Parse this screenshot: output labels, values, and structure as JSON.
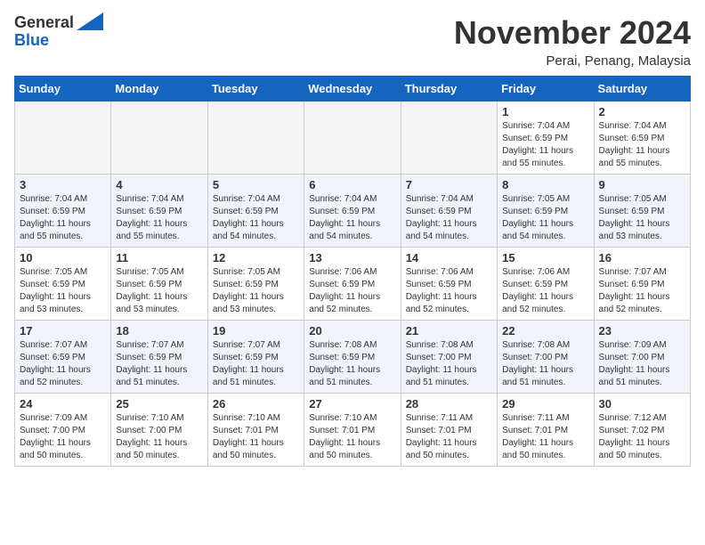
{
  "header": {
    "logo_line1": "General",
    "logo_line2": "Blue",
    "month_title": "November 2024",
    "location": "Perai, Penang, Malaysia"
  },
  "calendar": {
    "days_of_week": [
      "Sunday",
      "Monday",
      "Tuesday",
      "Wednesday",
      "Thursday",
      "Friday",
      "Saturday"
    ],
    "weeks": [
      [
        {
          "day": "",
          "info": ""
        },
        {
          "day": "",
          "info": ""
        },
        {
          "day": "",
          "info": ""
        },
        {
          "day": "",
          "info": ""
        },
        {
          "day": "",
          "info": ""
        },
        {
          "day": "1",
          "info": "Sunrise: 7:04 AM\nSunset: 6:59 PM\nDaylight: 11 hours\nand 55 minutes."
        },
        {
          "day": "2",
          "info": "Sunrise: 7:04 AM\nSunset: 6:59 PM\nDaylight: 11 hours\nand 55 minutes."
        }
      ],
      [
        {
          "day": "3",
          "info": "Sunrise: 7:04 AM\nSunset: 6:59 PM\nDaylight: 11 hours\nand 55 minutes."
        },
        {
          "day": "4",
          "info": "Sunrise: 7:04 AM\nSunset: 6:59 PM\nDaylight: 11 hours\nand 55 minutes."
        },
        {
          "day": "5",
          "info": "Sunrise: 7:04 AM\nSunset: 6:59 PM\nDaylight: 11 hours\nand 54 minutes."
        },
        {
          "day": "6",
          "info": "Sunrise: 7:04 AM\nSunset: 6:59 PM\nDaylight: 11 hours\nand 54 minutes."
        },
        {
          "day": "7",
          "info": "Sunrise: 7:04 AM\nSunset: 6:59 PM\nDaylight: 11 hours\nand 54 minutes."
        },
        {
          "day": "8",
          "info": "Sunrise: 7:05 AM\nSunset: 6:59 PM\nDaylight: 11 hours\nand 54 minutes."
        },
        {
          "day": "9",
          "info": "Sunrise: 7:05 AM\nSunset: 6:59 PM\nDaylight: 11 hours\nand 53 minutes."
        }
      ],
      [
        {
          "day": "10",
          "info": "Sunrise: 7:05 AM\nSunset: 6:59 PM\nDaylight: 11 hours\nand 53 minutes."
        },
        {
          "day": "11",
          "info": "Sunrise: 7:05 AM\nSunset: 6:59 PM\nDaylight: 11 hours\nand 53 minutes."
        },
        {
          "day": "12",
          "info": "Sunrise: 7:05 AM\nSunset: 6:59 PM\nDaylight: 11 hours\nand 53 minutes."
        },
        {
          "day": "13",
          "info": "Sunrise: 7:06 AM\nSunset: 6:59 PM\nDaylight: 11 hours\nand 52 minutes."
        },
        {
          "day": "14",
          "info": "Sunrise: 7:06 AM\nSunset: 6:59 PM\nDaylight: 11 hours\nand 52 minutes."
        },
        {
          "day": "15",
          "info": "Sunrise: 7:06 AM\nSunset: 6:59 PM\nDaylight: 11 hours\nand 52 minutes."
        },
        {
          "day": "16",
          "info": "Sunrise: 7:07 AM\nSunset: 6:59 PM\nDaylight: 11 hours\nand 52 minutes."
        }
      ],
      [
        {
          "day": "17",
          "info": "Sunrise: 7:07 AM\nSunset: 6:59 PM\nDaylight: 11 hours\nand 52 minutes."
        },
        {
          "day": "18",
          "info": "Sunrise: 7:07 AM\nSunset: 6:59 PM\nDaylight: 11 hours\nand 51 minutes."
        },
        {
          "day": "19",
          "info": "Sunrise: 7:07 AM\nSunset: 6:59 PM\nDaylight: 11 hours\nand 51 minutes."
        },
        {
          "day": "20",
          "info": "Sunrise: 7:08 AM\nSunset: 6:59 PM\nDaylight: 11 hours\nand 51 minutes."
        },
        {
          "day": "21",
          "info": "Sunrise: 7:08 AM\nSunset: 7:00 PM\nDaylight: 11 hours\nand 51 minutes."
        },
        {
          "day": "22",
          "info": "Sunrise: 7:08 AM\nSunset: 7:00 PM\nDaylight: 11 hours\nand 51 minutes."
        },
        {
          "day": "23",
          "info": "Sunrise: 7:09 AM\nSunset: 7:00 PM\nDaylight: 11 hours\nand 51 minutes."
        }
      ],
      [
        {
          "day": "24",
          "info": "Sunrise: 7:09 AM\nSunset: 7:00 PM\nDaylight: 11 hours\nand 50 minutes."
        },
        {
          "day": "25",
          "info": "Sunrise: 7:10 AM\nSunset: 7:00 PM\nDaylight: 11 hours\nand 50 minutes."
        },
        {
          "day": "26",
          "info": "Sunrise: 7:10 AM\nSunset: 7:01 PM\nDaylight: 11 hours\nand 50 minutes."
        },
        {
          "day": "27",
          "info": "Sunrise: 7:10 AM\nSunset: 7:01 PM\nDaylight: 11 hours\nand 50 minutes."
        },
        {
          "day": "28",
          "info": "Sunrise: 7:11 AM\nSunset: 7:01 PM\nDaylight: 11 hours\nand 50 minutes."
        },
        {
          "day": "29",
          "info": "Sunrise: 7:11 AM\nSunset: 7:01 PM\nDaylight: 11 hours\nand 50 minutes."
        },
        {
          "day": "30",
          "info": "Sunrise: 7:12 AM\nSunset: 7:02 PM\nDaylight: 11 hours\nand 50 minutes."
        }
      ]
    ]
  }
}
